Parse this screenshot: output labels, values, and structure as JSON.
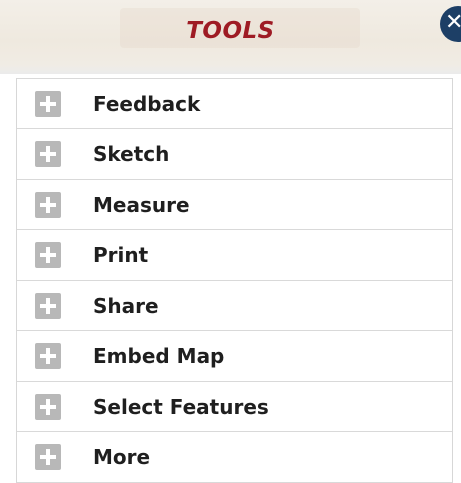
{
  "header": {
    "title": "TOOLS",
    "close_label": "✕"
  },
  "colors": {
    "title": "#9e1b24",
    "close_button": "#1d3f66",
    "plus_icon": "#b8b8b8",
    "label_text": "#1f1f1f"
  },
  "tools": {
    "items": [
      {
        "label": "Feedback",
        "icon": "plus-icon"
      },
      {
        "label": "Sketch",
        "icon": "plus-icon"
      },
      {
        "label": "Measure",
        "icon": "plus-icon"
      },
      {
        "label": "Print",
        "icon": "plus-icon"
      },
      {
        "label": "Share",
        "icon": "plus-icon"
      },
      {
        "label": "Embed Map",
        "icon": "plus-icon"
      },
      {
        "label": "Select Features",
        "icon": "plus-icon"
      },
      {
        "label": "More",
        "icon": "plus-icon"
      }
    ]
  }
}
